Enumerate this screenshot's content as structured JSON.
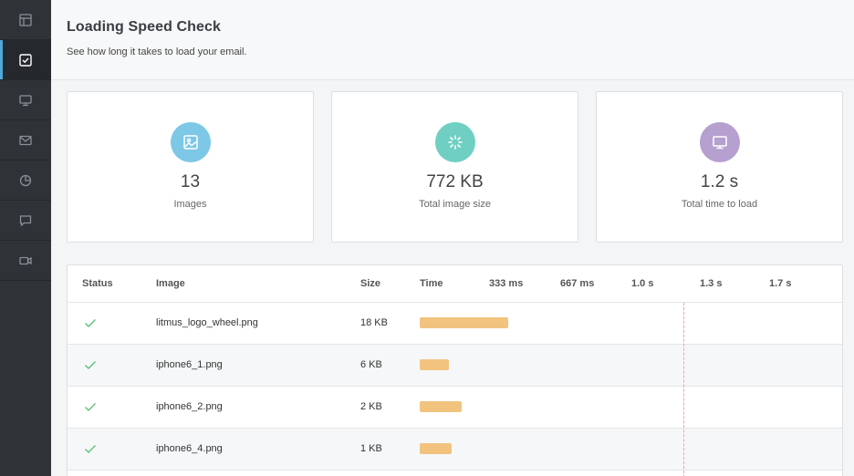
{
  "sidebar": {
    "items": [
      {
        "icon": "layout-icon"
      },
      {
        "icon": "checkbox-icon",
        "active": true
      },
      {
        "icon": "monitor-icon"
      },
      {
        "icon": "mail-icon"
      },
      {
        "icon": "pie-chart-icon"
      },
      {
        "icon": "chat-icon"
      },
      {
        "icon": "video-icon"
      }
    ]
  },
  "header": {
    "title": "Loading Speed Check",
    "subtitle": "See how long it takes to load your email."
  },
  "cards": [
    {
      "value": "13",
      "label": "Images",
      "color": "#7cc8e6",
      "icon": "image-icon"
    },
    {
      "value": "772 KB",
      "label": "Total image size",
      "color": "#6fcfc3",
      "icon": "spinner-icon"
    },
    {
      "value": "1.2 s",
      "label": "Total time to load",
      "color": "#b5a0cf",
      "icon": "monitor-icon"
    }
  ],
  "table": {
    "headers": {
      "status": "Status",
      "image": "Image",
      "size": "Size",
      "time": "Time",
      "t1": "333 ms",
      "t2": "667 ms",
      "t3": "1.0 s",
      "t4": "1.3 s",
      "t5": "1.7 s"
    },
    "rows": [
      {
        "name": "litmus_logo_wheel.png",
        "size": "18 KB"
      },
      {
        "name": "iphone6_1.png",
        "size": "6 KB"
      },
      {
        "name": "iphone6_2.png",
        "size": "2 KB"
      },
      {
        "name": "iphone6_4.png",
        "size": "1 KB"
      }
    ]
  },
  "colors": {
    "bar": "#f2c37f",
    "check": "#5cc07a",
    "marker": "#f1a8a8"
  }
}
